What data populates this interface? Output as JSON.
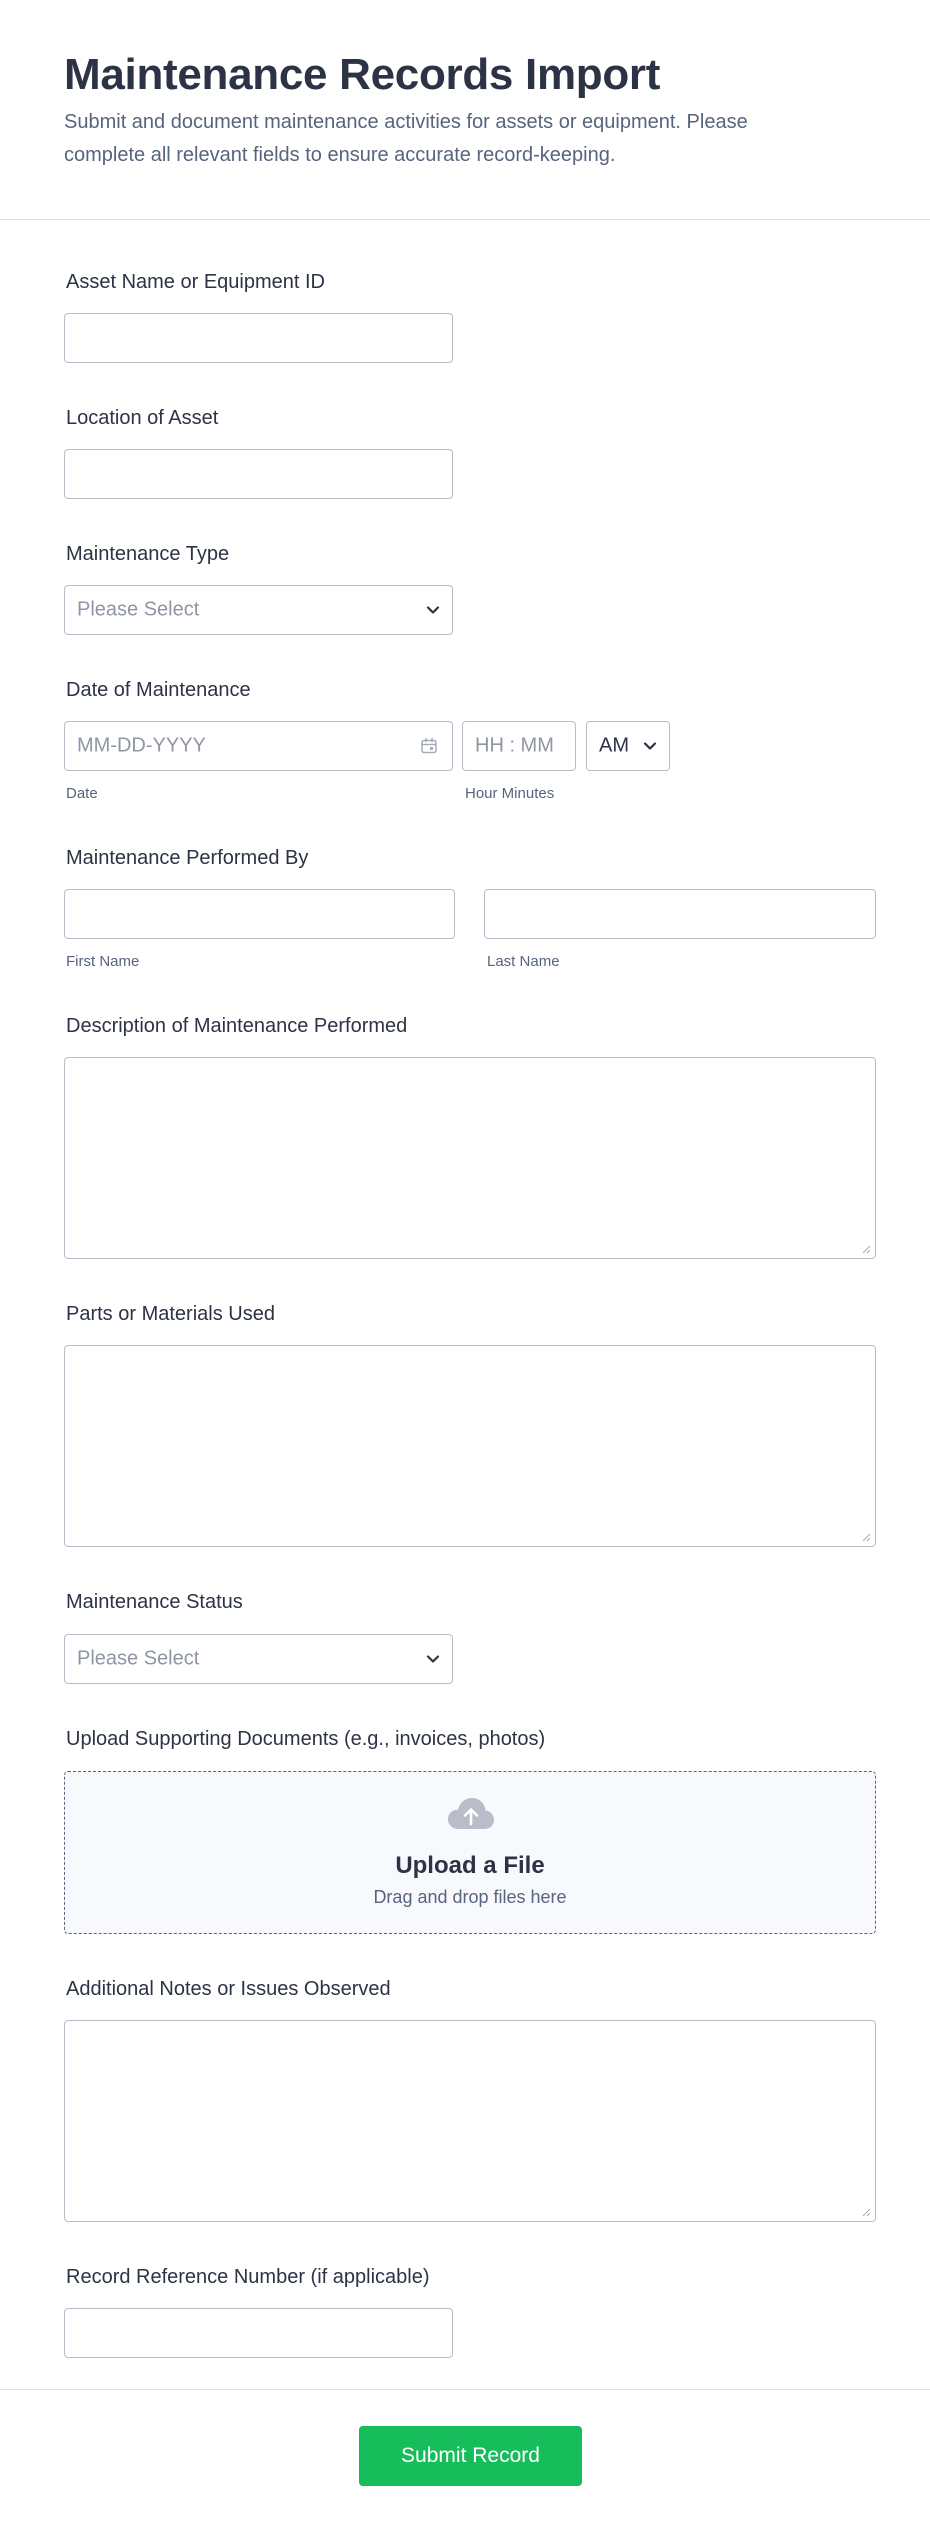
{
  "header": {
    "title": "Maintenance Records Import",
    "subtitle": "Submit and document maintenance activities for assets or equipment. Please complete all relevant fields to ensure accurate record-keeping."
  },
  "fields": {
    "asset_name": {
      "label": "Asset Name or Equipment ID"
    },
    "location": {
      "label": "Location of Asset"
    },
    "maintenance_type": {
      "label": "Maintenance Type",
      "placeholder": "Please Select"
    },
    "date": {
      "label": "Date of Maintenance",
      "date_placeholder": "MM-DD-YYYY",
      "time_placeholder": "HH : MM",
      "ampm_value": "AM",
      "date_sublabel": "Date",
      "time_sublabel": "Hour Minutes"
    },
    "performed_by": {
      "label": "Maintenance Performed By",
      "first_sublabel": "First Name",
      "last_sublabel": "Last Name"
    },
    "description": {
      "label": "Description of Maintenance Performed"
    },
    "parts": {
      "label": "Parts or Materials Used"
    },
    "status": {
      "label": "Maintenance Status",
      "placeholder": "Please Select"
    },
    "upload": {
      "label": "Upload Supporting Documents (e.g., invoices, photos)",
      "title": "Upload a File",
      "subtitle": "Drag and drop files here"
    },
    "notes": {
      "label": "Additional Notes or Issues Observed"
    },
    "reference": {
      "label": "Record Reference Number (if applicable)"
    }
  },
  "footer": {
    "submit_label": "Submit Record"
  },
  "colors": {
    "accent": "#18bd5b",
    "text": "#2c3345",
    "muted": "#57647e",
    "border": "#b8bdc9"
  },
  "icons": [
    "chevron-down-icon",
    "calendar-icon",
    "upload-cloud-icon",
    "resize-handle-icon"
  ]
}
